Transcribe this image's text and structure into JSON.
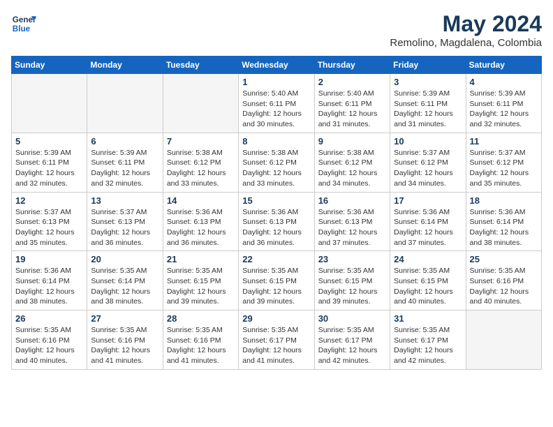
{
  "header": {
    "logo_line1": "General",
    "logo_line2": "Blue",
    "month_year": "May 2024",
    "location": "Remolino, Magdalena, Colombia"
  },
  "weekdays": [
    "Sunday",
    "Monday",
    "Tuesday",
    "Wednesday",
    "Thursday",
    "Friday",
    "Saturday"
  ],
  "weeks": [
    [
      {
        "day": "",
        "info": ""
      },
      {
        "day": "",
        "info": ""
      },
      {
        "day": "",
        "info": ""
      },
      {
        "day": "1",
        "info": "Sunrise: 5:40 AM\nSunset: 6:11 PM\nDaylight: 12 hours\nand 30 minutes."
      },
      {
        "day": "2",
        "info": "Sunrise: 5:40 AM\nSunset: 6:11 PM\nDaylight: 12 hours\nand 31 minutes."
      },
      {
        "day": "3",
        "info": "Sunrise: 5:39 AM\nSunset: 6:11 PM\nDaylight: 12 hours\nand 31 minutes."
      },
      {
        "day": "4",
        "info": "Sunrise: 5:39 AM\nSunset: 6:11 PM\nDaylight: 12 hours\nand 32 minutes."
      }
    ],
    [
      {
        "day": "5",
        "info": "Sunrise: 5:39 AM\nSunset: 6:11 PM\nDaylight: 12 hours\nand 32 minutes."
      },
      {
        "day": "6",
        "info": "Sunrise: 5:39 AM\nSunset: 6:11 PM\nDaylight: 12 hours\nand 32 minutes."
      },
      {
        "day": "7",
        "info": "Sunrise: 5:38 AM\nSunset: 6:12 PM\nDaylight: 12 hours\nand 33 minutes."
      },
      {
        "day": "8",
        "info": "Sunrise: 5:38 AM\nSunset: 6:12 PM\nDaylight: 12 hours\nand 33 minutes."
      },
      {
        "day": "9",
        "info": "Sunrise: 5:38 AM\nSunset: 6:12 PM\nDaylight: 12 hours\nand 34 minutes."
      },
      {
        "day": "10",
        "info": "Sunrise: 5:37 AM\nSunset: 6:12 PM\nDaylight: 12 hours\nand 34 minutes."
      },
      {
        "day": "11",
        "info": "Sunrise: 5:37 AM\nSunset: 6:12 PM\nDaylight: 12 hours\nand 35 minutes."
      }
    ],
    [
      {
        "day": "12",
        "info": "Sunrise: 5:37 AM\nSunset: 6:13 PM\nDaylight: 12 hours\nand 35 minutes."
      },
      {
        "day": "13",
        "info": "Sunrise: 5:37 AM\nSunset: 6:13 PM\nDaylight: 12 hours\nand 36 minutes."
      },
      {
        "day": "14",
        "info": "Sunrise: 5:36 AM\nSunset: 6:13 PM\nDaylight: 12 hours\nand 36 minutes."
      },
      {
        "day": "15",
        "info": "Sunrise: 5:36 AM\nSunset: 6:13 PM\nDaylight: 12 hours\nand 36 minutes."
      },
      {
        "day": "16",
        "info": "Sunrise: 5:36 AM\nSunset: 6:13 PM\nDaylight: 12 hours\nand 37 minutes."
      },
      {
        "day": "17",
        "info": "Sunrise: 5:36 AM\nSunset: 6:14 PM\nDaylight: 12 hours\nand 37 minutes."
      },
      {
        "day": "18",
        "info": "Sunrise: 5:36 AM\nSunset: 6:14 PM\nDaylight: 12 hours\nand 38 minutes."
      }
    ],
    [
      {
        "day": "19",
        "info": "Sunrise: 5:36 AM\nSunset: 6:14 PM\nDaylight: 12 hours\nand 38 minutes."
      },
      {
        "day": "20",
        "info": "Sunrise: 5:35 AM\nSunset: 6:14 PM\nDaylight: 12 hours\nand 38 minutes."
      },
      {
        "day": "21",
        "info": "Sunrise: 5:35 AM\nSunset: 6:15 PM\nDaylight: 12 hours\nand 39 minutes."
      },
      {
        "day": "22",
        "info": "Sunrise: 5:35 AM\nSunset: 6:15 PM\nDaylight: 12 hours\nand 39 minutes."
      },
      {
        "day": "23",
        "info": "Sunrise: 5:35 AM\nSunset: 6:15 PM\nDaylight: 12 hours\nand 39 minutes."
      },
      {
        "day": "24",
        "info": "Sunrise: 5:35 AM\nSunset: 6:15 PM\nDaylight: 12 hours\nand 40 minutes."
      },
      {
        "day": "25",
        "info": "Sunrise: 5:35 AM\nSunset: 6:16 PM\nDaylight: 12 hours\nand 40 minutes."
      }
    ],
    [
      {
        "day": "26",
        "info": "Sunrise: 5:35 AM\nSunset: 6:16 PM\nDaylight: 12 hours\nand 40 minutes."
      },
      {
        "day": "27",
        "info": "Sunrise: 5:35 AM\nSunset: 6:16 PM\nDaylight: 12 hours\nand 41 minutes."
      },
      {
        "day": "28",
        "info": "Sunrise: 5:35 AM\nSunset: 6:16 PM\nDaylight: 12 hours\nand 41 minutes."
      },
      {
        "day": "29",
        "info": "Sunrise: 5:35 AM\nSunset: 6:17 PM\nDaylight: 12 hours\nand 41 minutes."
      },
      {
        "day": "30",
        "info": "Sunrise: 5:35 AM\nSunset: 6:17 PM\nDaylight: 12 hours\nand 42 minutes."
      },
      {
        "day": "31",
        "info": "Sunrise: 5:35 AM\nSunset: 6:17 PM\nDaylight: 12 hours\nand 42 minutes."
      },
      {
        "day": "",
        "info": ""
      }
    ]
  ]
}
